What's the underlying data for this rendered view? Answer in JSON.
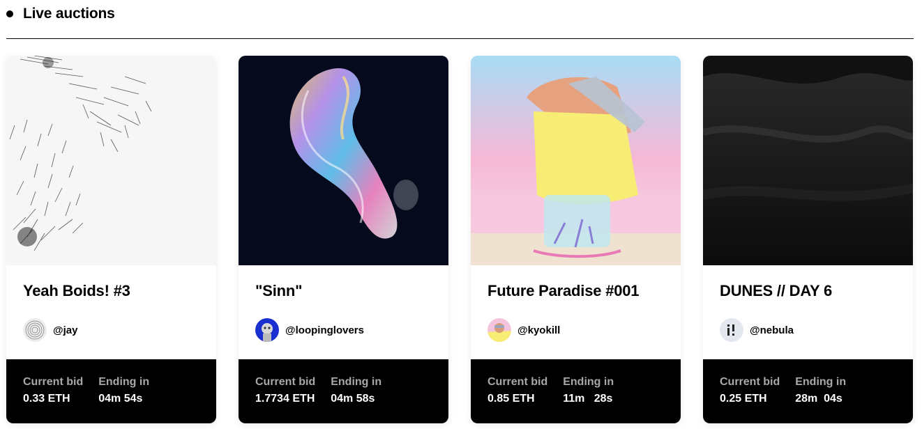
{
  "header": {
    "title": "Live auctions"
  },
  "auctions": [
    {
      "title": "Yeah Boids! #3",
      "creator": "@jay",
      "bid_label": "Current bid",
      "bid_value": "0.33 ETH",
      "ending_label": "Ending in",
      "ending_value": "04m 54s"
    },
    {
      "title": "\"Sinn\"",
      "creator": "@loopinglovers",
      "bid_label": "Current bid",
      "bid_value": "1.7734 ETH",
      "ending_label": "Ending in",
      "ending_value": "04m 58s"
    },
    {
      "title": "Future Paradise #001",
      "creator": "@kyokill",
      "bid_label": "Current bid",
      "bid_value": "0.85 ETH",
      "ending_label": "Ending in",
      "ending_value": "11m   28s"
    },
    {
      "title": "DUNES // DAY 6",
      "creator": "@nebula",
      "bid_label": "Current bid",
      "bid_value": "0.25 ETH",
      "ending_label": "Ending in",
      "ending_value": "28m  04s"
    }
  ]
}
